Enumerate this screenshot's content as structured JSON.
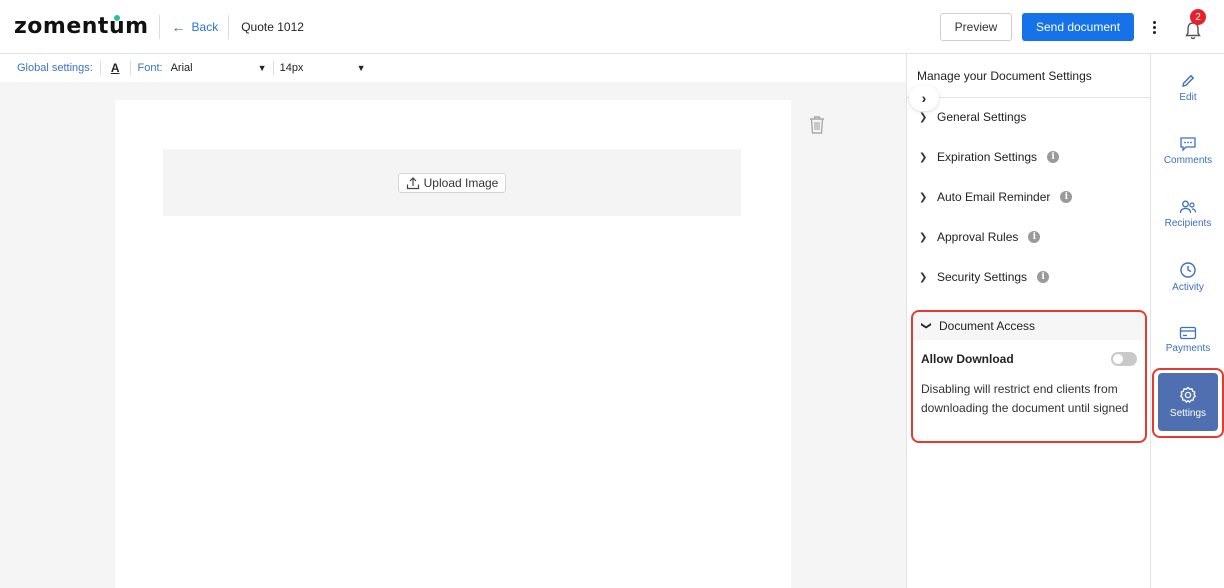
{
  "header": {
    "logo_text": "zomentum",
    "back_label": "Back",
    "quote_title": "Quote 1012",
    "preview_label": "Preview",
    "send_label": "Send document",
    "notification_count": "2",
    "icons": [
      "arrow-left-icon",
      "kebab-menu-icon",
      "bell-icon"
    ]
  },
  "global_settings": {
    "label": "Global settings:",
    "font_label": "Font:",
    "font_value": "Arial",
    "size_value": "14px",
    "icons": [
      "font-color-icon",
      "chevron-down-icon"
    ]
  },
  "canvas": {
    "upload_label": "Upload Image",
    "icons": [
      "upload-icon",
      "trash-icon"
    ]
  },
  "settings_panel": {
    "title": "Manage your Document Settings",
    "sections": [
      {
        "label": "General Settings",
        "info": false
      },
      {
        "label": "Expiration Settings",
        "info": true
      },
      {
        "label": "Auto Email Reminder",
        "info": true
      },
      {
        "label": "Approval Rules",
        "info": true
      },
      {
        "label": "Security Settings",
        "info": true
      }
    ],
    "document_access": {
      "label": "Document Access",
      "allow_download_label": "Allow Download",
      "allow_download_enabled": false,
      "description": "Disabling will restrict end clients from downloading the document until signed"
    }
  },
  "rail": {
    "items": [
      {
        "label": "Edit",
        "icon": "pencil-icon"
      },
      {
        "label": "Comments",
        "icon": "comment-icon"
      },
      {
        "label": "Recipients",
        "icon": "users-icon"
      },
      {
        "label": "Activity",
        "icon": "clock-icon"
      },
      {
        "label": "Payments",
        "icon": "card-icon"
      },
      {
        "label": "Settings",
        "icon": "gear-icon",
        "active": true
      }
    ]
  },
  "colors": {
    "accent": "#1572e8",
    "link": "#2a72d8",
    "rail_active": "#4f6fb0",
    "highlight": "#e53a2e",
    "badge": "#e8202a"
  }
}
